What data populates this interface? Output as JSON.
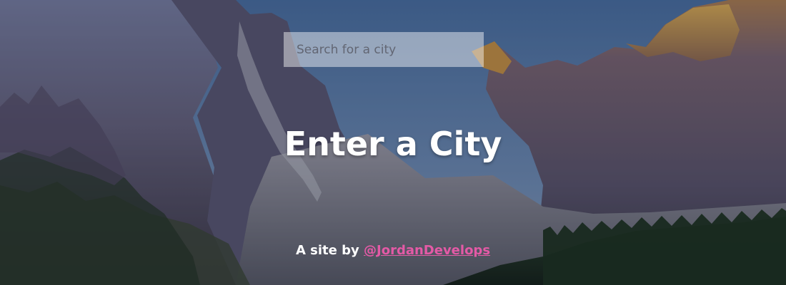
{
  "search": {
    "placeholder": "Search for a city"
  },
  "hero": {
    "title": "Enter a City"
  },
  "footer": {
    "prefix": "A site by",
    "link_text": "@JordanDevelops"
  },
  "colors": {
    "link": "#e45aa6",
    "text": "#ffffff"
  }
}
